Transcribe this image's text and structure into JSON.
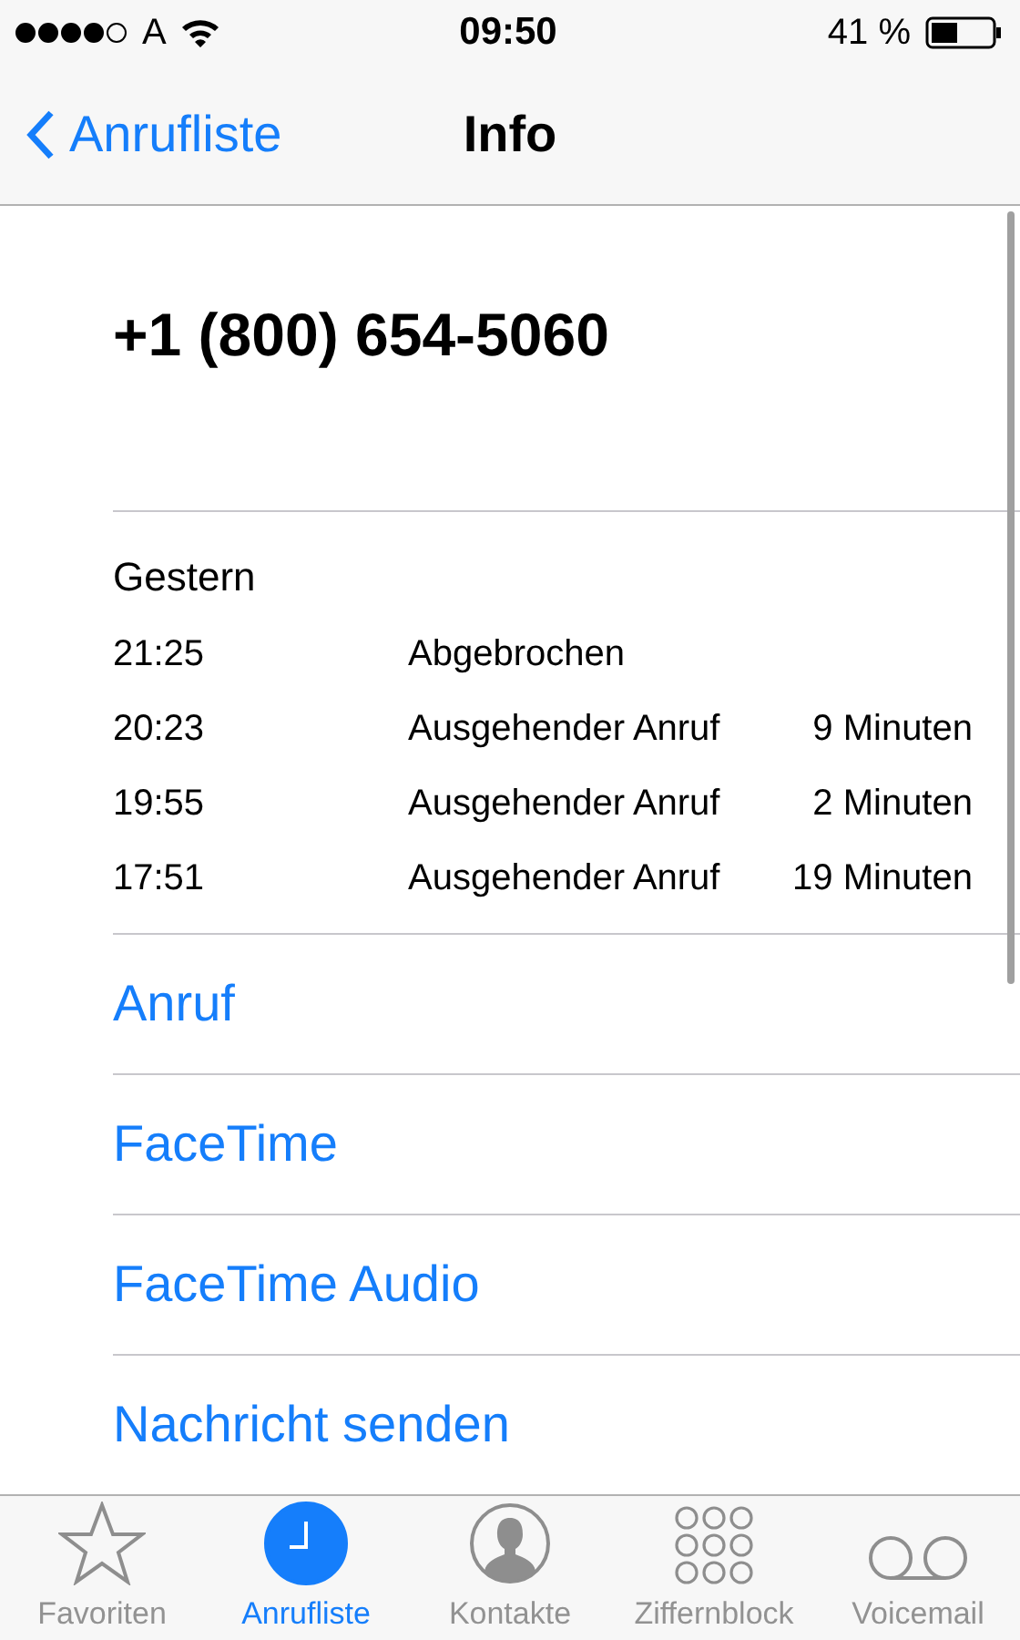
{
  "status_bar": {
    "carrier": "A",
    "time": "09:50",
    "battery": "41 %"
  },
  "nav": {
    "back": "Anrufliste",
    "title": "Info"
  },
  "contact": {
    "number": "+1 (800) 654-5060"
  },
  "calls": {
    "day": "Gestern",
    "rows": [
      {
        "time": "21:25",
        "type": "Abgebrochen"
      },
      {
        "time": "20:23",
        "type": "Ausgehender Anruf",
        "duration": "9 Minuten"
      },
      {
        "time": "19:55",
        "type": "Ausgehender Anruf",
        "duration": "2 Minuten"
      },
      {
        "time": "17:51",
        "type": "Ausgehender Anruf",
        "duration": "19 Minuten"
      }
    ]
  },
  "actions": [
    "Anruf",
    "FaceTime",
    "FaceTime Audio",
    "Nachricht senden"
  ],
  "tabs": [
    {
      "kind": "favorites",
      "label": "Favoriten",
      "selected": false
    },
    {
      "kind": "recents",
      "label": "Anrufliste",
      "selected": true
    },
    {
      "kind": "contacts",
      "label": "Kontakte",
      "selected": false
    },
    {
      "kind": "keypad",
      "label": "Ziffernblock",
      "selected": false
    },
    {
      "kind": "voicemail",
      "label": "Voicemail",
      "selected": false
    }
  ]
}
